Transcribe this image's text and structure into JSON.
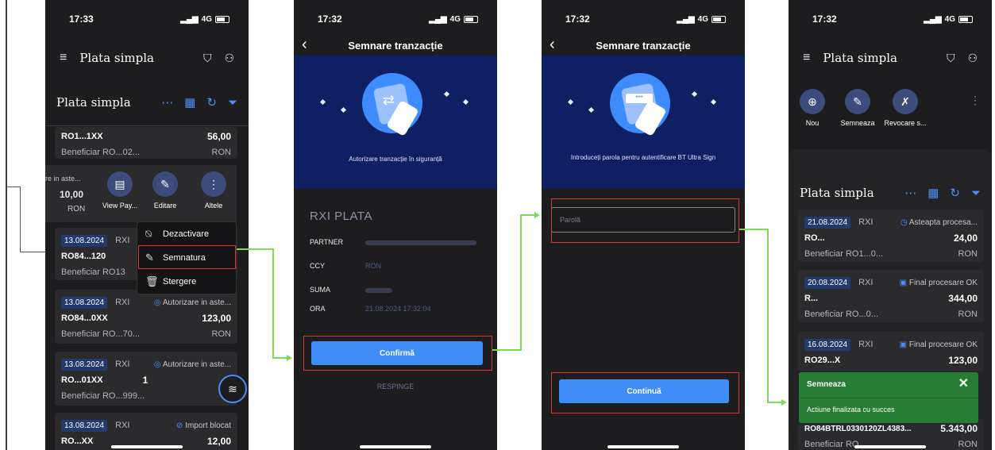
{
  "status_bar": {
    "time1": "17:33",
    "time2": "17:32",
    "time3": "17:32",
    "time4": "17:32",
    "network": "4G"
  },
  "screen1": {
    "header_title": "Plata simpla",
    "sub_title": "Plata simpla",
    "card0": {
      "iban": "RO1...1XX",
      "amount": "56,00",
      "beneficiar_label": "Beneficiar",
      "beneficiar_value": "RO...02...",
      "currency": "RON"
    },
    "swipe": {
      "status": "re in aste...",
      "amount": "10,00",
      "currency": "RON"
    },
    "actions": [
      {
        "label": "View Pay..."
      },
      {
        "label": "Editare"
      },
      {
        "label": "Altele"
      }
    ],
    "menu": [
      {
        "label": "Dezactivare"
      },
      {
        "label": "Semnatura"
      },
      {
        "label": "Stergere"
      }
    ],
    "card1": {
      "date": "13.08.2024",
      "type": "RXI",
      "iban": "RO84...120",
      "beneficiar_label": "Beneficiar",
      "beneficiar_value": "RO13"
    },
    "card2": {
      "date": "13.08.2024",
      "type": "RXI",
      "status": "Autorizare in aste...",
      "iban": "RO84...0XX",
      "amount": "123,00",
      "beneficiar_label": "Beneficiar",
      "beneficiar_value": "RO...70...",
      "currency": "RON"
    },
    "card3": {
      "date": "13.08.2024",
      "type": "RXI",
      "status": "Autorizare in aste...",
      "iban": "RO...01XX",
      "amount": "1",
      "beneficiar_label": "Beneficiar",
      "beneficiar_value": "RO...999..."
    },
    "card4": {
      "date": "13.08.2024",
      "type": "RXI",
      "status": "Import blocat",
      "iban": "RO...XX",
      "amount": "12,00"
    }
  },
  "screen2": {
    "title": "Semnare tranzacție",
    "hero_text": "Autorizare tranzacție în siguranță",
    "section": "RXI PLATA",
    "fields": [
      {
        "key": "PARTNER",
        "value": ""
      },
      {
        "key": "CCY",
        "value": "RON"
      },
      {
        "key": "SUMA",
        "value": ""
      },
      {
        "key": "ORA",
        "value": "21.08.2024 17:32:04"
      }
    ],
    "confirm": "Confirmă",
    "reject": "RESPINGE"
  },
  "screen3": {
    "title": "Semnare tranzacție",
    "hero_text": "Introduceți parola pentru autentificare BT Ultra Sign",
    "password_placeholder": "Parolă",
    "continue": "Continuă"
  },
  "screen4": {
    "header_title": "Plata simpla",
    "toolbar": [
      {
        "label": "Nou"
      },
      {
        "label": "Semneaza"
      },
      {
        "label": "Revocare s..."
      }
    ],
    "sub_title": "Plata simpla",
    "card1": {
      "date": "21.08.2024",
      "type": "RXI",
      "status": "Asteapta procesa...",
      "iban": "RO...",
      "amount": "24,00",
      "beneficiar_label": "Beneficiar",
      "beneficiar_value": "RO1...0...",
      "currency": "RON"
    },
    "card2": {
      "date": "20.08.2024",
      "type": "RXI",
      "status": "Final procesare OK",
      "iban": "R...",
      "amount": "344,00",
      "beneficiar_label": "Beneficiar",
      "beneficiar_value": "RO...0...",
      "currency": "RON"
    },
    "card3": {
      "date": "16.08.2024",
      "type": "RXI",
      "status": "Final procesare OK",
      "iban": "RO29...X",
      "amount": "123,00"
    },
    "card4": {
      "iban": "RO84BTRL0330120ZL4383...",
      "amount": "5.343,00",
      "beneficiar_label": "Beneficiar",
      "beneficiar_value": "RO...",
      "currency": "RON"
    },
    "toast": {
      "title": "Semneaza",
      "message": "Actiune finalizata cu succes"
    }
  },
  "colors": {
    "accent": "#3f8df6",
    "highlight": "#d9342b",
    "flow": "#7ed957",
    "success": "#267d33"
  }
}
